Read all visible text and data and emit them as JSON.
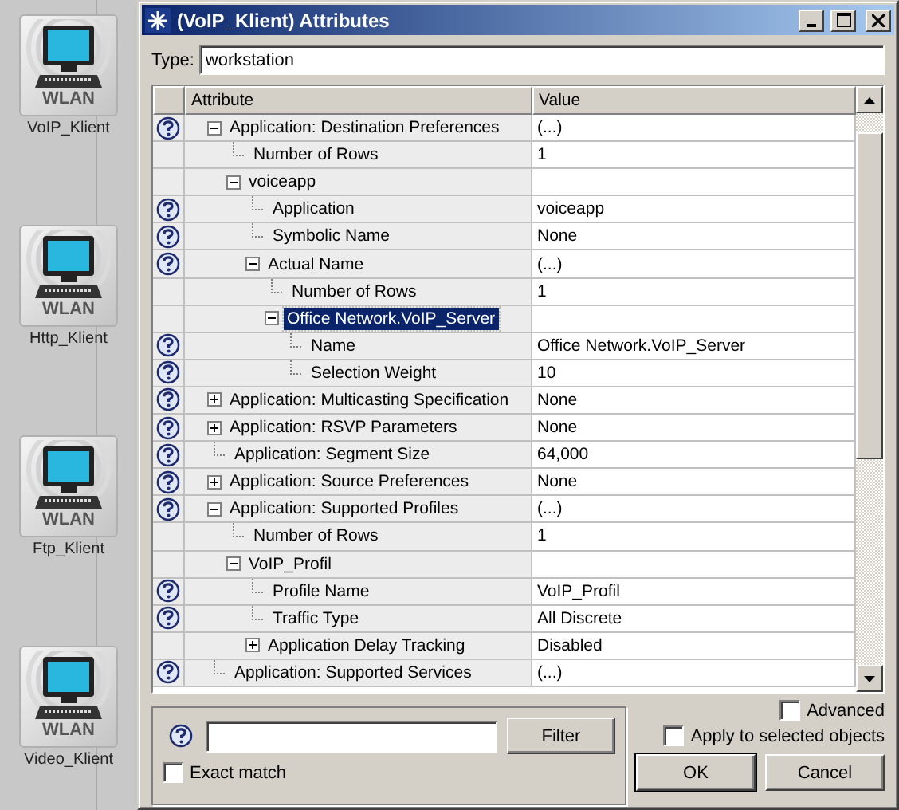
{
  "canvas": {
    "nodes": [
      {
        "badge": "WLAN",
        "label": "VoIP_Klient"
      },
      {
        "badge": "WLAN",
        "label": "Http_Klient"
      },
      {
        "badge": "WLAN",
        "label": "Ftp_Klient"
      },
      {
        "badge": "WLAN",
        "label": "Video_Klient"
      }
    ]
  },
  "window": {
    "title": "(VoIP_Klient) Attributes"
  },
  "type_field": {
    "label": "Type:",
    "value": "workstation"
  },
  "table": {
    "columns": [
      "Attribute",
      "Value"
    ],
    "rows": [
      {
        "label": "Application: Destination Preferences",
        "value": "(...)",
        "help": true,
        "expanded": true,
        "selected": false,
        "children": [
          {
            "label": "Number of Rows",
            "value": "1",
            "help": false,
            "selected": false
          },
          {
            "label": "voiceapp",
            "help": false,
            "expanded": true,
            "selected": false,
            "children": [
              {
                "label": "Application",
                "value": "voiceapp",
                "help": true,
                "selected": false
              },
              {
                "label": "Symbolic Name",
                "value": "None",
                "help": true,
                "selected": false
              },
              {
                "label": "Actual Name",
                "value": "(...)",
                "help": true,
                "expanded": true,
                "selected": false,
                "children": [
                  {
                    "label": "Number of Rows",
                    "value": "1",
                    "help": false,
                    "selected": false
                  },
                  {
                    "label": "Office Network.VoIP_Server",
                    "help": false,
                    "expanded": true,
                    "selected": true,
                    "children": [
                      {
                        "label": "Name",
                        "value": "Office Network.VoIP_Server",
                        "help": true,
                        "selected": false
                      },
                      {
                        "label": "Selection Weight",
                        "value": "10",
                        "help": true,
                        "selected": false
                      }
                    ]
                  }
                ]
              }
            ]
          }
        ]
      },
      {
        "label": "Application: Multicasting Specification",
        "value": "None",
        "help": true,
        "expanded": false,
        "selected": false
      },
      {
        "label": "Application: RSVP Parameters",
        "value": "None",
        "help": true,
        "expanded": false,
        "selected": false
      },
      {
        "label": "Application: Segment Size",
        "value": "64,000",
        "help": true,
        "selected": false
      },
      {
        "label": "Application: Source Preferences",
        "value": "None",
        "help": true,
        "expanded": false,
        "selected": false
      },
      {
        "label": "Application: Supported Profiles",
        "value": "(...)",
        "help": true,
        "expanded": true,
        "selected": false,
        "children": [
          {
            "label": "Number of Rows",
            "value": "1",
            "help": false,
            "selected": false
          },
          {
            "label": "VoIP_Profil",
            "help": false,
            "expanded": true,
            "selected": false,
            "children": [
              {
                "label": "Profile Name",
                "value": "VoIP_Profil",
                "help": true,
                "selected": false
              },
              {
                "label": "Traffic Type",
                "value": "All Discrete",
                "help": true,
                "selected": false
              },
              {
                "label": "Application Delay Tracking",
                "value": "Disabled",
                "help": false,
                "expanded": false,
                "selected": false
              }
            ]
          }
        ]
      },
      {
        "label": "Application: Supported Services",
        "value": "(...)",
        "help": true,
        "selected": false
      }
    ]
  },
  "filter": {
    "button": "Filter",
    "exact_match": {
      "label": "Exact match",
      "checked": false
    }
  },
  "options": [
    {
      "label": "Advanced",
      "checked": false
    },
    {
      "label": "Apply to selected objects",
      "checked": false
    }
  ],
  "buttons": [
    "OK",
    "Cancel"
  ]
}
